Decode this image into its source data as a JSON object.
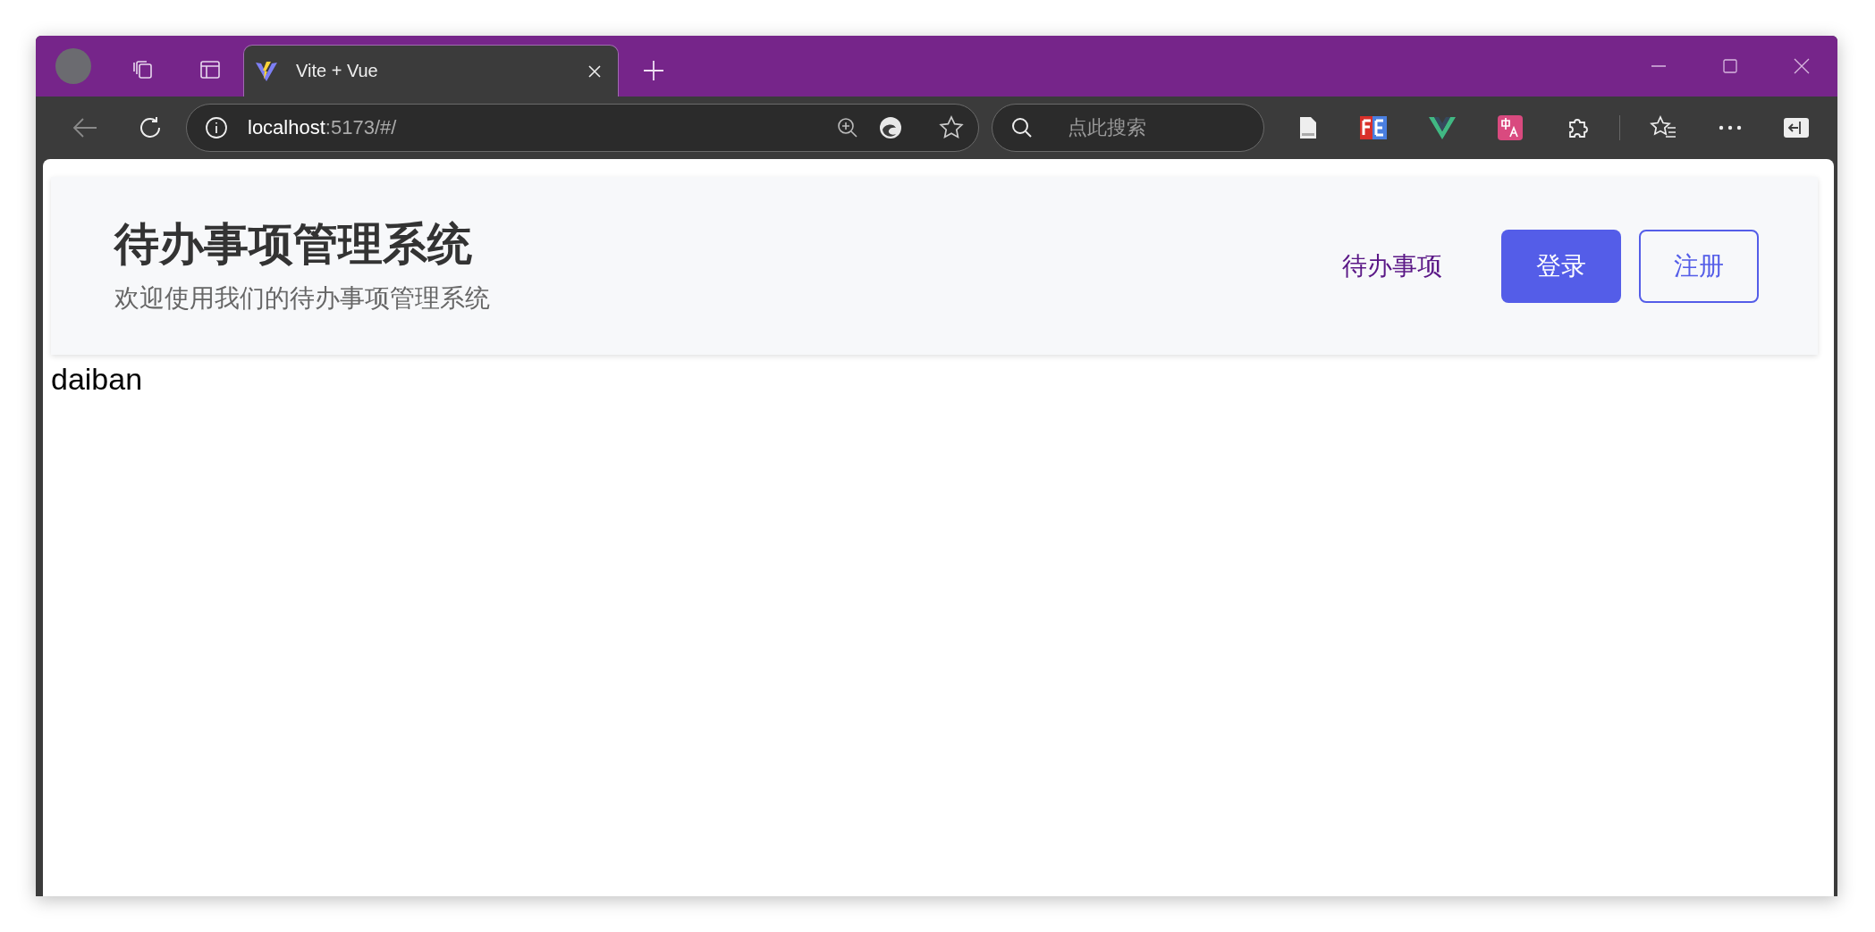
{
  "browser": {
    "tabs": [
      {
        "title": "Vite + Vue",
        "selected": true
      }
    ],
    "address": {
      "host": "localhost",
      "rest": ":5173/#/"
    },
    "search": {
      "placeholder": "点此搜索"
    }
  },
  "header": {
    "title": "待办事项管理系统",
    "subtitle": "欢迎使用我们的待办事项管理系统",
    "nav_link": "待办事项",
    "buttons": [
      {
        "label": "登录",
        "kind": "primary"
      },
      {
        "label": "注册",
        "kind": "outline"
      }
    ]
  },
  "content": {
    "text": "daiban"
  }
}
